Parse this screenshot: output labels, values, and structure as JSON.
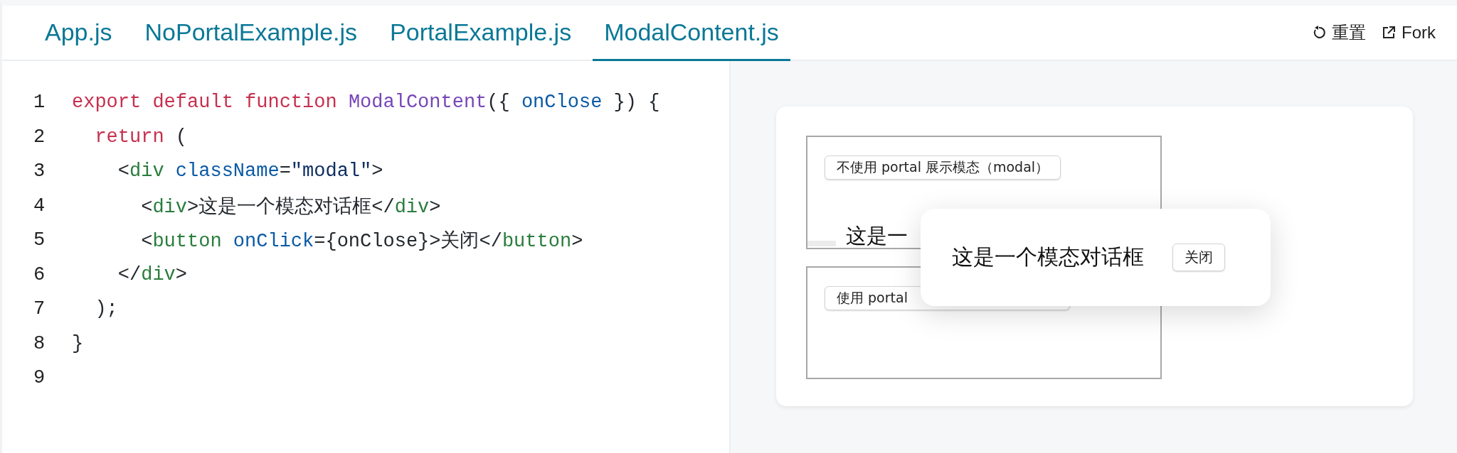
{
  "tabs": [
    {
      "label": "App.js",
      "selected": false
    },
    {
      "label": "NoPortalExample.js",
      "selected": false
    },
    {
      "label": "PortalExample.js",
      "selected": false
    },
    {
      "label": "ModalContent.js",
      "selected": true
    }
  ],
  "actions": [
    {
      "kind": "reset",
      "label": "重置"
    },
    {
      "kind": "fork",
      "label": "Fork"
    }
  ],
  "code_lines": [
    {
      "number": "1",
      "tokens": [
        {
          "kind": "kw",
          "text": "export default function "
        },
        {
          "kind": "fn",
          "text": "ModalContent"
        },
        {
          "kind": "plain",
          "text": "({ "
        },
        {
          "kind": "attr",
          "text": "onClose"
        },
        {
          "kind": "plain",
          "text": " }) {"
        }
      ]
    },
    {
      "number": "2",
      "tokens": [
        {
          "kind": "kw",
          "text": "  return"
        },
        {
          "kind": "plain",
          "text": " ("
        }
      ]
    },
    {
      "number": "3",
      "tokens": [
        {
          "kind": "plain",
          "text": "    <"
        },
        {
          "kind": "tag",
          "text": "div"
        },
        {
          "kind": "attr",
          "text": " className"
        },
        {
          "kind": "plain",
          "text": "="
        },
        {
          "kind": "str",
          "text": "\"modal\""
        },
        {
          "kind": "plain",
          "text": ">"
        }
      ]
    },
    {
      "number": "4",
      "tokens": [
        {
          "kind": "plain",
          "text": "      <"
        },
        {
          "kind": "tag",
          "text": "div"
        },
        {
          "kind": "plain",
          "text": ">这是一个模态对话框</"
        },
        {
          "kind": "tag",
          "text": "div"
        },
        {
          "kind": "plain",
          "text": ">"
        }
      ]
    },
    {
      "number": "5",
      "tokens": [
        {
          "kind": "plain",
          "text": "      <"
        },
        {
          "kind": "tag",
          "text": "button"
        },
        {
          "kind": "attr",
          "text": " onClick"
        },
        {
          "kind": "plain",
          "text": "={onClose}>关闭</"
        },
        {
          "kind": "tag",
          "text": "button"
        },
        {
          "kind": "plain",
          "text": ">"
        }
      ]
    },
    {
      "number": "6",
      "tokens": [
        {
          "kind": "plain",
          "text": "    </"
        },
        {
          "kind": "tag",
          "text": "div"
        },
        {
          "kind": "plain",
          "text": ">"
        }
      ]
    },
    {
      "number": "7",
      "tokens": [
        {
          "kind": "plain",
          "text": "  );"
        }
      ]
    },
    {
      "number": "8",
      "tokens": [
        {
          "kind": "plain",
          "text": "}"
        }
      ]
    },
    {
      "number": "9"
    }
  ],
  "preview": {
    "no_portal_box": {
      "button": "不使用 portal 展示模态（modal）",
      "text": "这是一"
    },
    "portal_box": {
      "button": "使用 portal"
    },
    "modal": {
      "text": "这是一个模态对话框",
      "button": "关闭"
    }
  }
}
